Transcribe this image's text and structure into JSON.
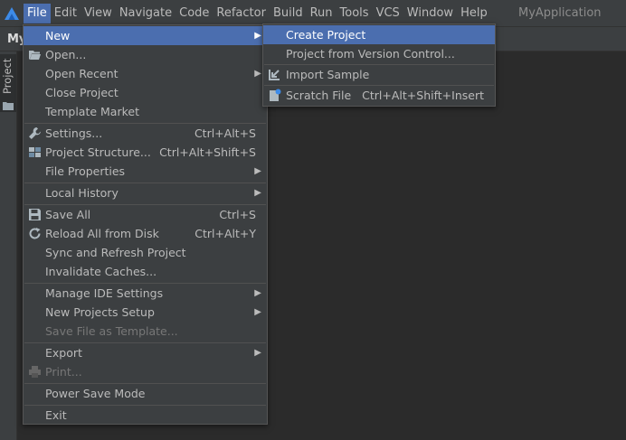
{
  "window": {
    "title": "MyApplication"
  },
  "menubar": {
    "items": [
      "File",
      "Edit",
      "View",
      "Navigate",
      "Code",
      "Refactor",
      "Build",
      "Run",
      "Tools",
      "VCS",
      "Window",
      "Help"
    ],
    "active_index": 0
  },
  "navbar": {
    "project_crumb": "My"
  },
  "tool_window_stripe": {
    "project_label": "Project"
  },
  "file_menu": {
    "items": [
      {
        "label": "New",
        "shortcut": "",
        "submenu": true,
        "selected": true
      },
      {
        "label": "Open...",
        "shortcut": "",
        "icon": "folder-open-icon"
      },
      {
        "label": "Open Recent",
        "shortcut": "",
        "submenu": true
      },
      {
        "label": "Close Project",
        "shortcut": ""
      },
      {
        "label": "Template Market",
        "shortcut": ""
      },
      {
        "label": "Settings...",
        "shortcut": "Ctrl+Alt+S",
        "icon": "wrench-icon"
      },
      {
        "label": "Project Structure...",
        "shortcut": "Ctrl+Alt+Shift+S",
        "icon": "project-structure-icon"
      },
      {
        "label": "File Properties",
        "shortcut": "",
        "submenu": true
      },
      {
        "label": "Local History",
        "shortcut": "",
        "submenu": true
      },
      {
        "label": "Save All",
        "shortcut": "Ctrl+S",
        "icon": "save-icon"
      },
      {
        "label": "Reload All from Disk",
        "shortcut": "Ctrl+Alt+Y",
        "icon": "reload-icon"
      },
      {
        "label": "Sync and Refresh Project",
        "shortcut": ""
      },
      {
        "label": "Invalidate Caches...",
        "shortcut": ""
      },
      {
        "label": "Manage IDE Settings",
        "shortcut": "",
        "submenu": true
      },
      {
        "label": "New Projects Setup",
        "shortcut": "",
        "submenu": true
      },
      {
        "label": "Save File as Template...",
        "shortcut": "",
        "disabled": true
      },
      {
        "label": "Export",
        "shortcut": "",
        "submenu": true
      },
      {
        "label": "Print...",
        "shortcut": "",
        "disabled": true,
        "icon": "print-icon"
      },
      {
        "label": "Power Save Mode",
        "shortcut": ""
      },
      {
        "label": "Exit",
        "shortcut": ""
      }
    ]
  },
  "new_submenu": {
    "items": [
      {
        "label": "Create Project",
        "shortcut": "",
        "selected": true
      },
      {
        "label": "Project from Version Control...",
        "shortcut": ""
      },
      {
        "label": "Import Sample",
        "shortcut": "",
        "icon": "import-icon"
      },
      {
        "label": "Scratch File",
        "shortcut": "Ctrl+Alt+Shift+Insert",
        "icon": "scratch-file-icon"
      }
    ]
  },
  "colors": {
    "menubar_bg": "#3c3f41",
    "editor_bg": "#2b2b2b",
    "selection": "#4b6eaf",
    "text": "#bbbbbb",
    "disabled_text": "#777777"
  }
}
